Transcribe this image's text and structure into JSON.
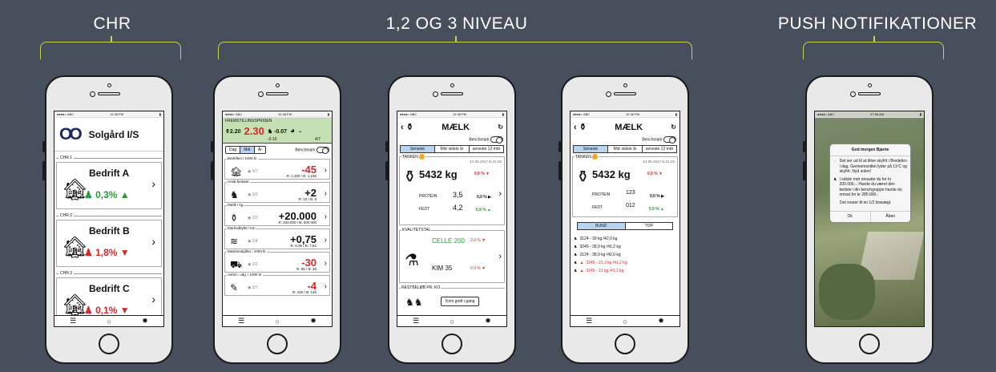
{
  "sections": {
    "chr": "CHR",
    "levels": "1,2 OG 3 NIVEAU",
    "push": "PUSH NOTIFIKATIONER"
  },
  "status": {
    "carrier": "●●●●○ ABC",
    "time": "12:38 PM",
    "push_time": "07:58 AM"
  },
  "phone1": {
    "farm_name": "Solgård I/S",
    "items": [
      {
        "label": "CHR 1",
        "title": "Bedrift A",
        "value": "0,3%",
        "trend": "up"
      },
      {
        "label": "CHR 2",
        "title": "Bedrift B",
        "value": "1,8%",
        "trend": "down"
      },
      {
        "label": "CHR 3",
        "title": "Bedrift C",
        "value": "0,1%",
        "trend": "down"
      }
    ]
  },
  "phone2": {
    "header_label": "FREMSTILLINGSPRISEN",
    "left_val": "2.20",
    "main_val": "2.30",
    "main_sub": "-0.10",
    "right_val": "-0.07",
    "score": "4/7",
    "tabs": [
      "Dag",
      "Mdr",
      "År"
    ],
    "benchmark": "Benchmark",
    "items": [
      {
        "label": "Bedriften i 1000 kr",
        "score": "6/7",
        "value": "-45",
        "sub": "R: 1.200 / B: 1.245"
      },
      {
        "label": "Antal årskøer",
        "score": "3/3",
        "value": "+2",
        "sub": "R: 10 / B: 8"
      },
      {
        "label": "Mælk i kg",
        "score": "2/3",
        "value": "+20.000",
        "sub": "R: 220.000 / B: 200.000"
      },
      {
        "label": "Markudbytte i ton",
        "score": "2/4",
        "value": "+0,75",
        "sub": "R: 8,36 / B: 7,61"
      },
      {
        "label": "Maskinudgifter i 1000 kr",
        "score": "1/2",
        "value": "-30",
        "sub": "R: 65 / B: 35"
      },
      {
        "label": "Admin. udg. i 1000 kr",
        "score": "5/7",
        "value": "-4",
        "sub": "R: 150 / B: 146"
      }
    ]
  },
  "phone3": {
    "title": "MÆLK",
    "benchmark": "Benchmark",
    "tabs": [
      "Seneste",
      "Mdr sidste år",
      "seneste 12 mdr"
    ],
    "tank_label": "TANKEN",
    "date": "12.06.2017 kl 21:32",
    "amount": "5432 kg",
    "amount_pct": "0,9 %",
    "rows": [
      {
        "name": "PROTEIN",
        "val": "3,5",
        "pct": "0,0 %"
      },
      {
        "name": "FEDT",
        "val": "4,2",
        "pct": "0,9 %"
      }
    ],
    "quality_label": "KVALITETSTAL",
    "celle": "CELLE 200",
    "celle_pct": "0,9 %",
    "kim": "KIM 35",
    "kim_pct": "0,9 %",
    "rest_label": "RESTBELØB PR. KO",
    "rest_button": "Kom godt i gang"
  },
  "phone4": {
    "title": "MÆLK",
    "benchmark": "Benchmark",
    "tabs": [
      "Seneste",
      "Mdr sidste år",
      "seneste 12 mdr"
    ],
    "tank_label": "TANKEN",
    "date": "12.06.2017 kl 21:32",
    "amount": "5432 kg",
    "amount_pct": "0,9 %",
    "rows": [
      {
        "name": "PROTEIN",
        "val": "123",
        "pct": "0,0 %"
      },
      {
        "name": "FEDT",
        "val": "012",
        "pct": "0,9 %"
      }
    ],
    "list_tabs": [
      "BUND",
      "TOP"
    ],
    "cows": [
      {
        "text": "3124 - 39 kg /42,0 kg",
        "warn": false
      },
      {
        "text": "3245 - 38,9 kg /41,2 kg",
        "warn": false
      },
      {
        "text": "3124 - 38,9 kg /42,0 kg",
        "warn": false
      },
      {
        "text": "3245 - 21,3 kg /41,2 kg",
        "warn": true
      },
      {
        "text": "3249 - 21 kg /41,1 kg",
        "warn": true
      }
    ]
  },
  "phone5": {
    "dialog_title": "God morgen Bjarne",
    "msg1": "Det ser ud til at blive skyfrit i Bredebro i dag. Gennemsnittet lyder på 11ºC og skyfrit. Nyd solen!",
    "msg2": "I sidste mdr omsatte du for kr 200.000,-. Havde du været den bedste i din benchgruppe havde du omsat for kr 285.000,-",
    "msg3": "Det svarer til en 1/2 bravægt.",
    "ok": "Ok",
    "open": "Åben"
  }
}
